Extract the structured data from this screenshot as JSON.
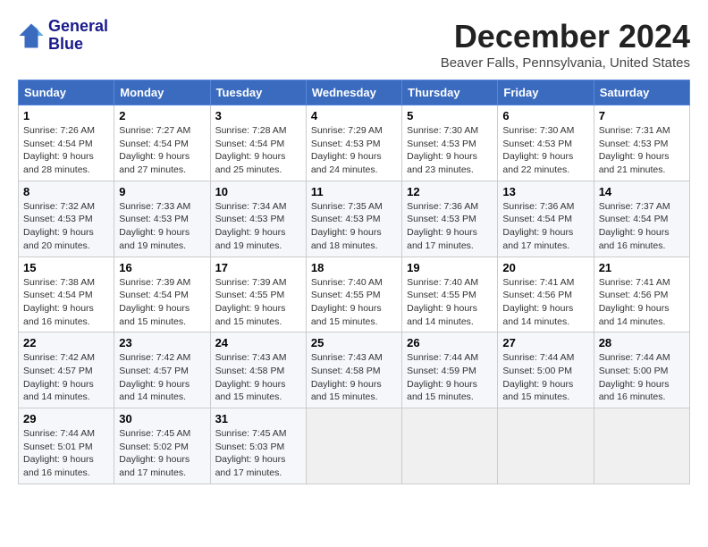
{
  "logo": {
    "line1": "General",
    "line2": "Blue"
  },
  "title": "December 2024",
  "location": "Beaver Falls, Pennsylvania, United States",
  "weekdays": [
    "Sunday",
    "Monday",
    "Tuesday",
    "Wednesday",
    "Thursday",
    "Friday",
    "Saturday"
  ],
  "weeks": [
    [
      {
        "day": "1",
        "sunrise": "7:26 AM",
        "sunset": "4:54 PM",
        "daylight": "9 hours and 28 minutes."
      },
      {
        "day": "2",
        "sunrise": "7:27 AM",
        "sunset": "4:54 PM",
        "daylight": "9 hours and 27 minutes."
      },
      {
        "day": "3",
        "sunrise": "7:28 AM",
        "sunset": "4:54 PM",
        "daylight": "9 hours and 25 minutes."
      },
      {
        "day": "4",
        "sunrise": "7:29 AM",
        "sunset": "4:53 PM",
        "daylight": "9 hours and 24 minutes."
      },
      {
        "day": "5",
        "sunrise": "7:30 AM",
        "sunset": "4:53 PM",
        "daylight": "9 hours and 23 minutes."
      },
      {
        "day": "6",
        "sunrise": "7:30 AM",
        "sunset": "4:53 PM",
        "daylight": "9 hours and 22 minutes."
      },
      {
        "day": "7",
        "sunrise": "7:31 AM",
        "sunset": "4:53 PM",
        "daylight": "9 hours and 21 minutes."
      }
    ],
    [
      {
        "day": "8",
        "sunrise": "7:32 AM",
        "sunset": "4:53 PM",
        "daylight": "9 hours and 20 minutes."
      },
      {
        "day": "9",
        "sunrise": "7:33 AM",
        "sunset": "4:53 PM",
        "daylight": "9 hours and 19 minutes."
      },
      {
        "day": "10",
        "sunrise": "7:34 AM",
        "sunset": "4:53 PM",
        "daylight": "9 hours and 19 minutes."
      },
      {
        "day": "11",
        "sunrise": "7:35 AM",
        "sunset": "4:53 PM",
        "daylight": "9 hours and 18 minutes."
      },
      {
        "day": "12",
        "sunrise": "7:36 AM",
        "sunset": "4:53 PM",
        "daylight": "9 hours and 17 minutes."
      },
      {
        "day": "13",
        "sunrise": "7:36 AM",
        "sunset": "4:54 PM",
        "daylight": "9 hours and 17 minutes."
      },
      {
        "day": "14",
        "sunrise": "7:37 AM",
        "sunset": "4:54 PM",
        "daylight": "9 hours and 16 minutes."
      }
    ],
    [
      {
        "day": "15",
        "sunrise": "7:38 AM",
        "sunset": "4:54 PM",
        "daylight": "9 hours and 16 minutes."
      },
      {
        "day": "16",
        "sunrise": "7:39 AM",
        "sunset": "4:54 PM",
        "daylight": "9 hours and 15 minutes."
      },
      {
        "day": "17",
        "sunrise": "7:39 AM",
        "sunset": "4:55 PM",
        "daylight": "9 hours and 15 minutes."
      },
      {
        "day": "18",
        "sunrise": "7:40 AM",
        "sunset": "4:55 PM",
        "daylight": "9 hours and 15 minutes."
      },
      {
        "day": "19",
        "sunrise": "7:40 AM",
        "sunset": "4:55 PM",
        "daylight": "9 hours and 14 minutes."
      },
      {
        "day": "20",
        "sunrise": "7:41 AM",
        "sunset": "4:56 PM",
        "daylight": "9 hours and 14 minutes."
      },
      {
        "day": "21",
        "sunrise": "7:41 AM",
        "sunset": "4:56 PM",
        "daylight": "9 hours and 14 minutes."
      }
    ],
    [
      {
        "day": "22",
        "sunrise": "7:42 AM",
        "sunset": "4:57 PM",
        "daylight": "9 hours and 14 minutes."
      },
      {
        "day": "23",
        "sunrise": "7:42 AM",
        "sunset": "4:57 PM",
        "daylight": "9 hours and 14 minutes."
      },
      {
        "day": "24",
        "sunrise": "7:43 AM",
        "sunset": "4:58 PM",
        "daylight": "9 hours and 15 minutes."
      },
      {
        "day": "25",
        "sunrise": "7:43 AM",
        "sunset": "4:58 PM",
        "daylight": "9 hours and 15 minutes."
      },
      {
        "day": "26",
        "sunrise": "7:44 AM",
        "sunset": "4:59 PM",
        "daylight": "9 hours and 15 minutes."
      },
      {
        "day": "27",
        "sunrise": "7:44 AM",
        "sunset": "5:00 PM",
        "daylight": "9 hours and 15 minutes."
      },
      {
        "day": "28",
        "sunrise": "7:44 AM",
        "sunset": "5:00 PM",
        "daylight": "9 hours and 16 minutes."
      }
    ],
    [
      {
        "day": "29",
        "sunrise": "7:44 AM",
        "sunset": "5:01 PM",
        "daylight": "9 hours and 16 minutes."
      },
      {
        "day": "30",
        "sunrise": "7:45 AM",
        "sunset": "5:02 PM",
        "daylight": "9 hours and 17 minutes."
      },
      {
        "day": "31",
        "sunrise": "7:45 AM",
        "sunset": "5:03 PM",
        "daylight": "9 hours and 17 minutes."
      },
      null,
      null,
      null,
      null
    ]
  ],
  "labels": {
    "sunrise": "Sunrise:",
    "sunset": "Sunset:",
    "daylight": "Daylight:"
  }
}
